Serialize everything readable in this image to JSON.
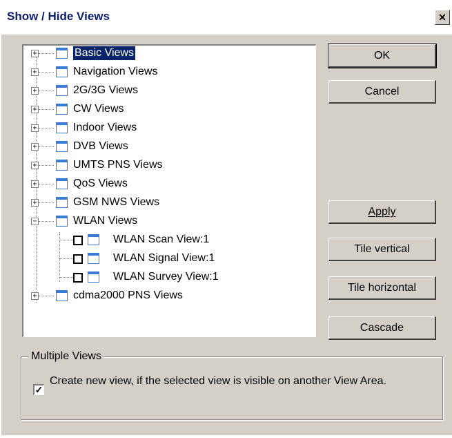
{
  "window": {
    "title": "Show / Hide Views",
    "close_glyph": "✕"
  },
  "tree": {
    "groups": [
      {
        "label": "Basic Views",
        "expander": "+",
        "selected": true
      },
      {
        "label": "Navigation Views",
        "expander": "+"
      },
      {
        "label": "2G/3G Views",
        "expander": "+"
      },
      {
        "label": "CW Views",
        "expander": "+"
      },
      {
        "label": "Indoor Views",
        "expander": "+"
      },
      {
        "label": "DVB Views",
        "expander": "+"
      },
      {
        "label": "UMTS PNS Views",
        "expander": "+"
      },
      {
        "label": "QoS Views",
        "expander": "+"
      },
      {
        "label": "GSM NWS Views",
        "expander": "+"
      },
      {
        "label": "WLAN Views",
        "expander": "−"
      },
      {
        "label": "cdma2000 PNS Views",
        "expander": "+"
      }
    ],
    "wlan_children": [
      {
        "label": "WLAN Scan View:1",
        "checked": false
      },
      {
        "label": "WLAN Signal View:1",
        "checked": false
      },
      {
        "label": "WLAN Survey View:1",
        "checked": false
      }
    ]
  },
  "buttons": {
    "ok": "OK",
    "cancel": "Cancel",
    "apply": "Apply",
    "tile_vertical": "Tile vertical",
    "tile_horizontal": "Tile horizontal",
    "cascade": "Cascade"
  },
  "multiple_views": {
    "group_label": "Multiple Views",
    "option_text": "Create new view, if the selected view is visible on another View Area.",
    "checked": true,
    "check_glyph": "✓"
  },
  "colors": {
    "selection": "#0a246a",
    "icon_blue": "#3a7bd5",
    "title_text": "#0a1f6e"
  }
}
